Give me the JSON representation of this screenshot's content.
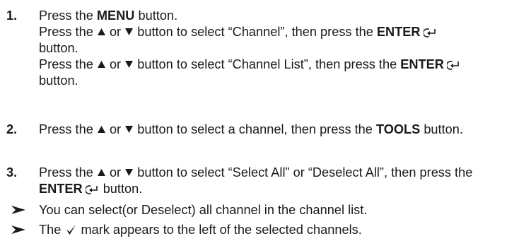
{
  "steps": [
    {
      "number": "1.",
      "lines": [
        {
          "t1": "Press the ",
          "b1": "MENU",
          "t2": " button."
        },
        {
          "t1": "Press the ",
          "or": " or ",
          "t2": " button to select “Channel”, then press the ",
          "b1": "ENTER"
        },
        {
          "t1": "button."
        },
        {
          "t1": "Press the ",
          "or": " or ",
          "t2": " button to select “Channel List”, then press the ",
          "b1": "ENTER"
        },
        {
          "t1": "button."
        }
      ]
    },
    {
      "number": "2.",
      "lines": [
        {
          "t1": "Press the ",
          "or": " or ",
          "t2": " button to select a channel, then press the ",
          "b1": "TOOLS",
          "t3": " button."
        }
      ]
    },
    {
      "number": "3.",
      "lines": [
        {
          "t1": "Press the ",
          "or": " or ",
          "t2": " button to select “Select All” or “Deselect All”, then press the"
        },
        {
          "b1": "ENTER",
          "t2": " button."
        }
      ]
    }
  ],
  "notes": [
    {
      "t1": "You can select(or Deselect) all channel in the channel list."
    },
    {
      "t1": "The ",
      "t2": " mark appears to the left of the selected channels."
    }
  ],
  "icons": {
    "up": "up-triangle-icon",
    "down": "down-triangle-icon",
    "enter": "enter-icon",
    "arrow": "note-arrow-icon",
    "check": "check-mark-icon"
  }
}
